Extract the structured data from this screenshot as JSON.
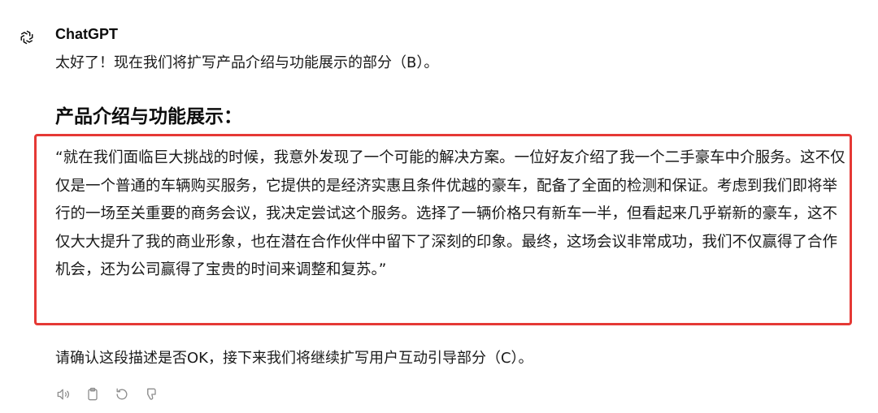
{
  "message": {
    "author": "ChatGPT",
    "avatar_icon": "openai-logo-icon",
    "intro": "太好了！现在我们将扩写产品介绍与功能展示的部分（B）。",
    "section_heading": "产品介绍与功能展示：",
    "quote": "“就在我们面临巨大挑战的时候，我意外发现了一个可能的解决方案。一位好友介绍了我一个二手豪车中介服务。这不仅仅是一个普通的车辆购买服务，它提供的是经济实惠且条件优越的豪车，配备了全面的检测和保证。考虑到我们即将举行的一场至关重要的商务会议，我决定尝试这个服务。选择了一辆价格只有新车一半，但看起来几乎崭新的豪车，这不仅大大提升了我的商业形象，也在潜在合作伙伴中留下了深刻的印象。最终，这场会议非常成功，我们不仅赢得了合作机会，还为公司赢得了宝贵的时间来调整和复苏。”",
    "followup": "请确认这段描述是否OK，接下来我们将继续扩写用户互动引导部分（C）。",
    "highlight_color": "#e53935"
  },
  "actions": [
    {
      "icon": "speaker-icon"
    },
    {
      "icon": "clipboard-icon"
    },
    {
      "icon": "regenerate-icon"
    },
    {
      "icon": "thumbs-down-icon"
    }
  ]
}
